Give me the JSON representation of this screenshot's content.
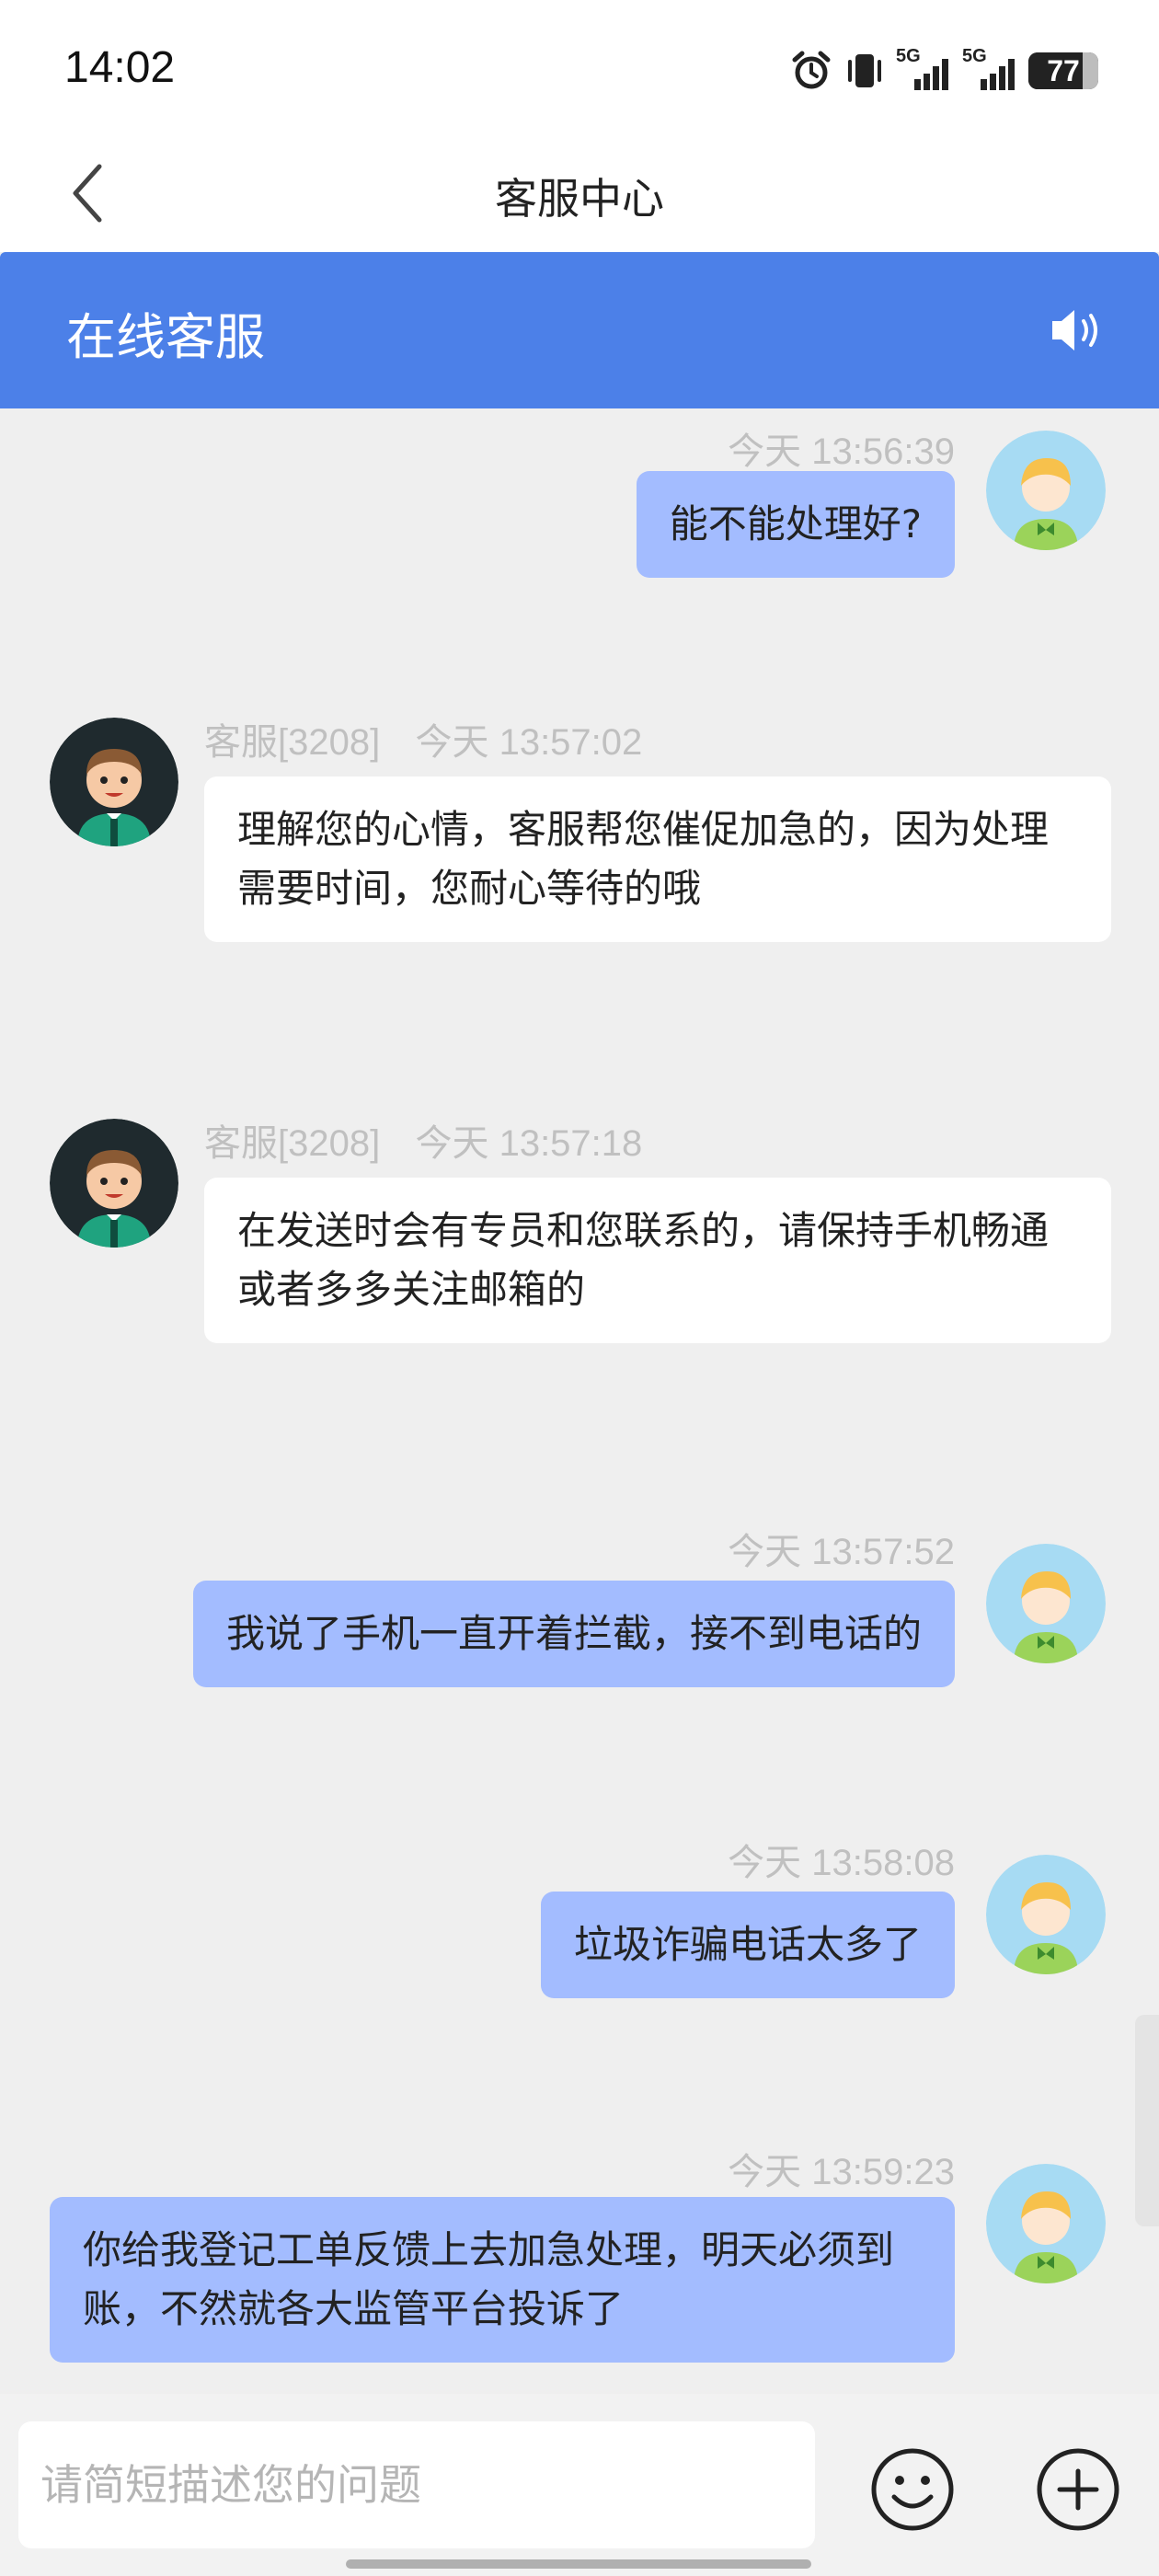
{
  "status_bar": {
    "time": "14:02",
    "icons": [
      "alarm-icon",
      "vibrate-icon",
      "signal-5g-icon",
      "signal-5g-icon",
      "battery-icon"
    ],
    "network_label_1": "5G",
    "network_label_2": "5G",
    "battery": "77",
    "battery_level": 0.77
  },
  "nav": {
    "title": "客服中心",
    "back_icon": "chevron-left-icon"
  },
  "service_header": {
    "title": "在线客服",
    "speaker_icon": "speaker-icon"
  },
  "messages": [
    {
      "sender": "user",
      "time": "今天 13:56:39",
      "text": "能不能处理好?"
    },
    {
      "sender": "agent",
      "agent_id": "客服[3208]",
      "time": "今天 13:57:02",
      "text": "理解您的心情，客服帮您催促加急的，因为处理需要时间，您耐心等待的哦"
    },
    {
      "sender": "agent",
      "agent_id": "客服[3208]",
      "time": "今天 13:57:18",
      "text": "在发送时会有专员和您联系的，请保持手机畅通或者多多关注邮箱的"
    },
    {
      "sender": "user",
      "time": "今天 13:57:52",
      "text": "我说了手机一直开着拦截，接不到电话的"
    },
    {
      "sender": "user",
      "time": "今天 13:58:08",
      "text": "垃圾诈骗电话太多了"
    },
    {
      "sender": "user",
      "time": "今天 13:59:23",
      "text": "你给我登记工单反馈上去加急处理，明天必须到账，不然就各大监管平台投诉了"
    }
  ],
  "input": {
    "placeholder": "请简短描述您的问题",
    "emoji_icon": "emoji-icon",
    "plus_icon": "plus-icon"
  },
  "colors": {
    "accent": "#4c80e8",
    "user_bubble": "#a3bcff",
    "agent_bubble": "#ffffff",
    "background": "#efefef"
  }
}
